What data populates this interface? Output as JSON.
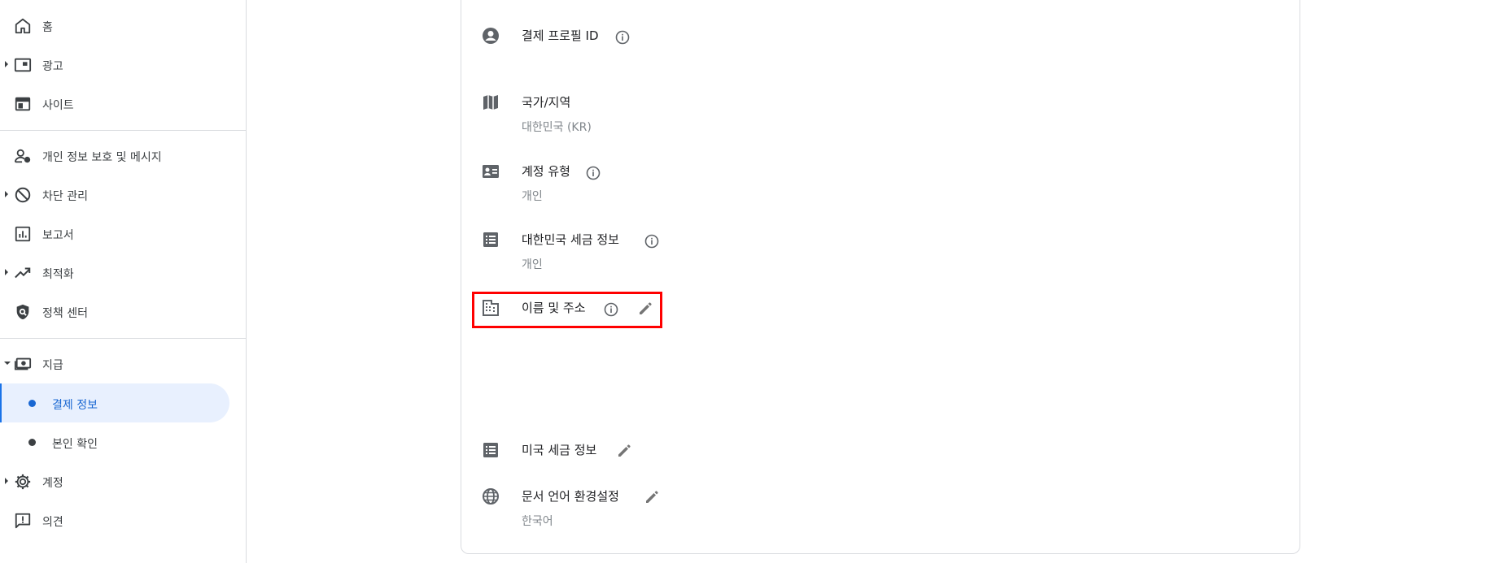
{
  "sidebar": {
    "items": [
      {
        "label": "홈",
        "icon": "home-icon"
      },
      {
        "label": "광고",
        "icon": "ads-icon"
      },
      {
        "label": "사이트",
        "icon": "sites-icon"
      },
      {
        "label": "개인 정보 보호 및 메시지",
        "icon": "privacy-messaging-icon"
      },
      {
        "label": "차단 관리",
        "icon": "block-icon"
      },
      {
        "label": "보고서",
        "icon": "reports-icon"
      },
      {
        "label": "최적화",
        "icon": "trending-icon"
      },
      {
        "label": "정책 센터",
        "icon": "policy-shield-icon"
      },
      {
        "label": "지급",
        "icon": "payments-icon"
      },
      {
        "label": "결제 정보",
        "icon": "dot"
      },
      {
        "label": "본인 확인",
        "icon": "dot"
      },
      {
        "label": "계정",
        "icon": "gear-icon"
      },
      {
        "label": "의견",
        "icon": "feedback-icon"
      }
    ],
    "active_item": "결제 정보",
    "accent_color": "#1a73e8"
  },
  "main": {
    "rows": [
      {
        "label": "결제 프로필 ID",
        "value": "",
        "icon": "account-circle-icon",
        "info": true,
        "edit": false
      },
      {
        "label": "국가/지역",
        "value": "대한민국 (KR)",
        "icon": "map-icon",
        "info": false,
        "edit": false
      },
      {
        "label": "계정 유형",
        "value": "개인",
        "icon": "contact-card-icon",
        "info": true,
        "edit": false
      },
      {
        "label": "대한민국 세금 정보",
        "value": "개인",
        "icon": "list-icon",
        "info": true,
        "edit": false
      },
      {
        "label": "이름 및 주소",
        "value": "",
        "icon": "building-icon",
        "info": true,
        "edit": true
      },
      {
        "label": "미국 세금 정보",
        "value": "",
        "icon": "list-icon",
        "info": false,
        "edit": true
      },
      {
        "label": "문서 언어 환경설정",
        "value": "한국어",
        "icon": "globe-icon",
        "info": false,
        "edit": true
      }
    ],
    "highlight_color": "#ff0000"
  }
}
